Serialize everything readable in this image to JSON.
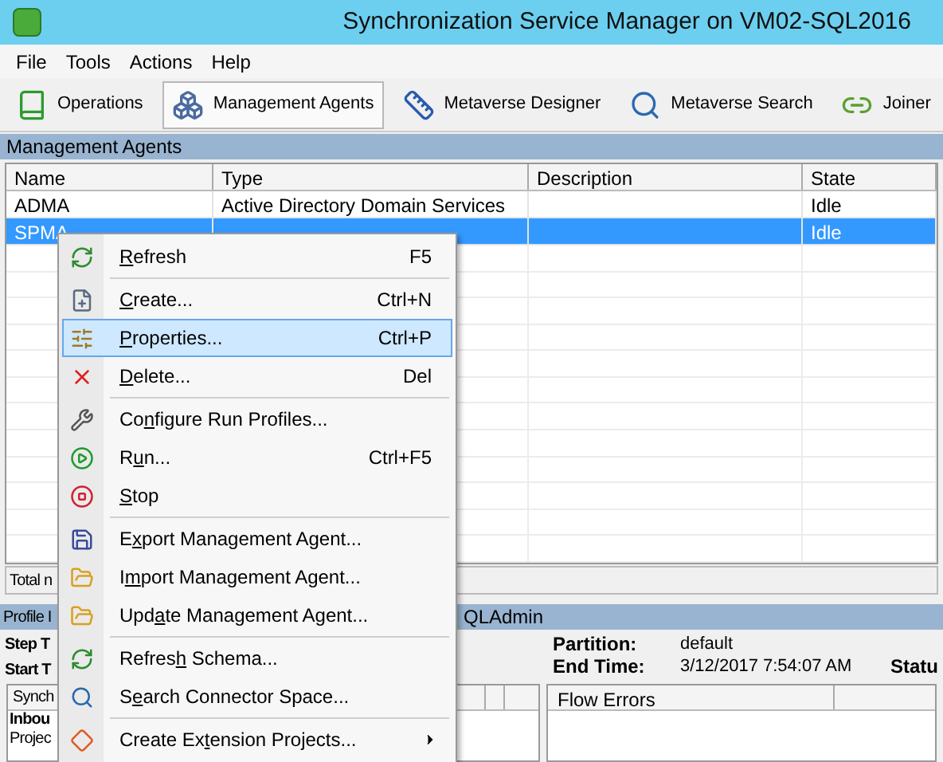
{
  "window": {
    "title": "Synchronization Service Manager on VM02-SQL2016"
  },
  "menu_bar": [
    "File",
    "Tools",
    "Actions",
    "Help"
  ],
  "toolbar": [
    {
      "label": "Operations",
      "selected": false
    },
    {
      "label": "Management Agents",
      "selected": true
    },
    {
      "label": "Metaverse Designer",
      "selected": false
    },
    {
      "label": "Metaverse Search",
      "selected": false
    },
    {
      "label": "Joiner",
      "selected": false
    }
  ],
  "panel_title": "Management Agents",
  "table": {
    "columns": [
      "Name",
      "Type",
      "Description",
      "State"
    ],
    "rows": [
      {
        "cells": [
          "ADMA",
          "Active Directory Domain Services",
          "",
          "Idle"
        ],
        "selected": false
      },
      {
        "cells": [
          "SPMA",
          "",
          "",
          "Idle"
        ],
        "selected": true
      }
    ]
  },
  "total_label": "Total n",
  "profile_bar": {
    "left": "Profile I",
    "right": "QLAdmin"
  },
  "details": {
    "step": "Step T",
    "start": "Start T",
    "partition_label": "Partition:",
    "partition_value": "default",
    "end_label": "End Time:",
    "end_value": "3/12/2017 7:54:07 AM",
    "status_label": "Statu"
  },
  "sync_grid": {
    "column": "Synch",
    "rows": [
      {
        "text": "Inbou",
        "bold": true
      },
      {
        "text": "Projec",
        "bold": false
      }
    ]
  },
  "flow_errors": {
    "column": "Flow Errors"
  },
  "context_menu": [
    {
      "label": {
        "accel": "R",
        "after": "efresh"
      },
      "shortcut": "F5",
      "selected": false,
      "separator_after": true,
      "submenu": false
    },
    {
      "label": {
        "accel": "C",
        "after": "reate..."
      },
      "shortcut": "Ctrl+N",
      "selected": false,
      "separator_after": false,
      "submenu": false
    },
    {
      "label": {
        "accel": "P",
        "after": "roperties..."
      },
      "shortcut": "Ctrl+P",
      "selected": true,
      "separator_after": false,
      "submenu": false
    },
    {
      "label": {
        "accel": "D",
        "after": "elete..."
      },
      "shortcut": "Del",
      "selected": false,
      "separator_after": true,
      "submenu": false
    },
    {
      "label": {
        "before": "Co",
        "accel": "n",
        "after": "figure Run Profiles..."
      },
      "selected": false,
      "separator_after": false,
      "submenu": false
    },
    {
      "label": {
        "before": "R",
        "accel": "u",
        "after": "n..."
      },
      "shortcut": "Ctrl+F5",
      "selected": false,
      "separator_after": false,
      "submenu": false
    },
    {
      "label": {
        "accel": "S",
        "after": "top"
      },
      "selected": false,
      "separator_after": true,
      "submenu": false
    },
    {
      "label": {
        "before": "E",
        "accel": "x",
        "after": "port Management Agent..."
      },
      "selected": false,
      "separator_after": false,
      "submenu": false
    },
    {
      "label": {
        "before": "I",
        "accel": "m",
        "after": "port Management Agent..."
      },
      "selected": false,
      "separator_after": false,
      "submenu": false
    },
    {
      "label": {
        "before": "Upd",
        "accel": "a",
        "after": "te Management Agent..."
      },
      "selected": false,
      "separator_after": true,
      "submenu": false
    },
    {
      "label": {
        "before": "Refres",
        "accel": "h",
        "after": " Schema..."
      },
      "selected": false,
      "separator_after": false,
      "submenu": false
    },
    {
      "label": {
        "before": "S",
        "accel": "e",
        "after": "arch Connector Space..."
      },
      "selected": false,
      "separator_after": true,
      "submenu": false
    },
    {
      "label": {
        "before": "Create Ex",
        "accel": "t",
        "after": "ension Projects..."
      },
      "selected": false,
      "separator_after": false,
      "submenu": true
    }
  ]
}
